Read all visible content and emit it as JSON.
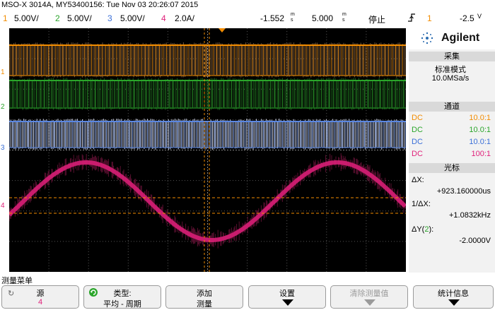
{
  "header": {
    "title": "MSO-X 3014A, MY53400156: Tue Nov 03 20:26:07 2015"
  },
  "status_bar": {
    "channels": [
      {
        "num": "1",
        "scale": "5.00V/",
        "color": "#f28c00"
      },
      {
        "num": "2",
        "scale": "5.00V/",
        "color": "#2aa52a"
      },
      {
        "num": "3",
        "scale": "5.00V/",
        "color": "#3a6fd8"
      },
      {
        "num": "4",
        "scale": "2.0A/",
        "color": "#e0207a"
      }
    ],
    "time_offset": "-1.552",
    "time_offset_unit_top": "m",
    "time_offset_unit_bottom": "s",
    "timebase": "5.000",
    "timebase_unit_top": "m",
    "timebase_unit_bottom": "s",
    "run_state": "停止",
    "trigger_channel": "1",
    "trigger_level": "-2.5",
    "trigger_level_unit": "V"
  },
  "panel": {
    "brand": "Agilent",
    "acquire": {
      "header": "采集",
      "mode": "标准模式",
      "rate": "10.0MSa/s"
    },
    "channels": {
      "header": "通道",
      "rows": [
        {
          "coupling": "DC",
          "probe": "10.0:1",
          "color": "#f28c00"
        },
        {
          "coupling": "DC",
          "probe": "10.0:1",
          "color": "#2aa52a"
        },
        {
          "coupling": "DC",
          "probe": "10.0:1",
          "color": "#3a6fd8"
        },
        {
          "coupling": "DC",
          "probe": "100:1",
          "color": "#e0207a"
        }
      ]
    },
    "cursors": {
      "header": "光标",
      "dx_label": "ΔX:",
      "dx_value": "+923.160000us",
      "inv_dx_label": "1/ΔX:",
      "inv_dx_value": "+1.0832kHz",
      "dy_label": "ΔY(",
      "dy_channel": "2",
      "dy_label_end": "):",
      "dy_value": "-2.0000V"
    }
  },
  "softkeys": {
    "menu_title": "测量菜单",
    "buttons": [
      {
        "line1": "源",
        "line2": "4"
      },
      {
        "line1": "类型:",
        "line2": "平均 - 周期"
      },
      {
        "line1": "添加",
        "line2": "测量"
      },
      {
        "line1": "设置",
        "line2": ""
      },
      {
        "line1": "清除测量值",
        "line2": ""
      },
      {
        "line1": "统计信息",
        "line2": ""
      }
    ]
  },
  "markers": {
    "ch1": "1",
    "ch2": "2",
    "ch3": "3",
    "ch4": "4"
  }
}
